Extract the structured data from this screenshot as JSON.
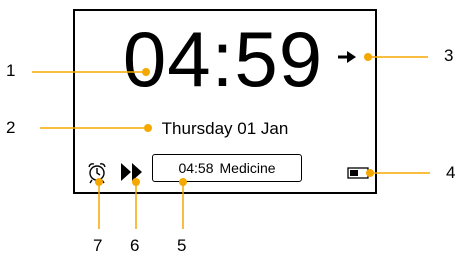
{
  "screen": {
    "clock_time": "04:59",
    "date": "Thursday 01 Jan",
    "next_alarm": {
      "time": "04:58",
      "label": "Medicine"
    }
  },
  "icons": {
    "arrow": "arrow-right-icon",
    "alarm": "alarm-clock-icon",
    "fast_forward": "fast-forward-icon",
    "battery": "battery-icon"
  },
  "callouts": [
    "1",
    "2",
    "3",
    "4",
    "5",
    "6",
    "7"
  ],
  "colors": {
    "leader": "#f5a800",
    "ink": "#000000"
  }
}
